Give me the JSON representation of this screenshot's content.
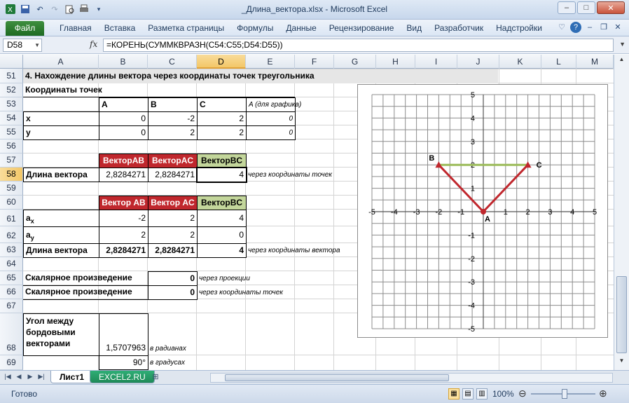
{
  "window": {
    "title": "_Длина_вектора.xlsx - Microsoft Excel",
    "qat_icons": [
      "excel-logo-icon",
      "save-icon",
      "undo-icon",
      "redo-icon",
      "print-preview-icon",
      "quick-print-icon"
    ]
  },
  "ribbon": {
    "file_tab": "Файл",
    "tabs": [
      "Главная",
      "Вставка",
      "Разметка страницы",
      "Формулы",
      "Данные",
      "Рецензирование",
      "Вид",
      "Разработчик",
      "Надстройки"
    ]
  },
  "formula_bar": {
    "name_box": "D58",
    "fx_label": "fx",
    "formula": "=КОРЕНЬ(СУММКВРАЗН(C54:C55;D54:D55))"
  },
  "columns": [
    "A",
    "B",
    "C",
    "D",
    "E",
    "F",
    "G",
    "H",
    "I",
    "J",
    "K",
    "L",
    "M"
  ],
  "rows": [
    "51",
    "52",
    "53",
    "54",
    "55",
    "56",
    "57",
    "58",
    "59",
    "60",
    "61",
    "62",
    "63",
    "64",
    "65",
    "66",
    "67",
    "68",
    "69"
  ],
  "selected": {
    "column": "D",
    "row": "58"
  },
  "cells": {
    "r51": "4. Нахождение длины вектора через координаты точек треугольника",
    "r52": "Координаты точек",
    "r53": {
      "B": "A",
      "C": "B",
      "D": "C",
      "E": "A (для графика)"
    },
    "r54": {
      "A": "x",
      "B": "0",
      "C": "-2",
      "D": "2",
      "E": "0"
    },
    "r55": {
      "A": "y",
      "B": "0",
      "C": "2",
      "D": "2",
      "E": "0"
    },
    "r57": {
      "B": "ВекторAB",
      "C": "ВекторAC",
      "D": "ВекторBC"
    },
    "r58": {
      "A": "Длина вектора",
      "B": "2,8284271",
      "C": "2,8284271",
      "D": "4",
      "E": "через координаты точек"
    },
    "r60": {
      "B": "Вектор AB",
      "C": "Вектор AC",
      "D": "ВекторBC"
    },
    "r61": {
      "A_main": "a",
      "A_sub": "x",
      "B": "-2",
      "C": "2",
      "D": "4"
    },
    "r62": {
      "A_main": "a",
      "A_sub": "y",
      "B": "2",
      "C": "2",
      "D": "0"
    },
    "r63": {
      "A": "Длина вектора",
      "B": "2,8284271",
      "C": "2,8284271",
      "D": "4",
      "E": "через координаты вектора"
    },
    "r65": {
      "A": "Скалярное произведение",
      "D": "0",
      "E": "через проекции"
    },
    "r66": {
      "A": "Скалярное произведение",
      "D": "0",
      "E": "через координаты точек"
    },
    "r68": {
      "A1": "Угол между",
      "A2": "бордовыми",
      "A3": "векторами",
      "B": "1,5707963",
      "C": "в радианах"
    },
    "r69": {
      "B": "90°",
      "C": "в градусах"
    }
  },
  "chart_data": {
    "type": "scatter",
    "xlim": [
      -5,
      5
    ],
    "ylim": [
      -5,
      5
    ],
    "grid": true,
    "x_ticks": [
      "-5",
      "-4",
      "-3",
      "-2",
      "-1",
      "0",
      "1",
      "2",
      "3",
      "4",
      "5"
    ],
    "y_ticks": [
      "5",
      "4",
      "3",
      "2",
      "1",
      "0",
      "-1",
      "-2",
      "-3",
      "-4",
      "-5"
    ],
    "points": [
      {
        "label": "A",
        "x": 0,
        "y": 0
      },
      {
        "label": "B",
        "x": -2,
        "y": 2
      },
      {
        "label": "C",
        "x": 2,
        "y": 2
      }
    ],
    "series": [
      {
        "from": [
          0,
          0
        ],
        "to": [
          -2,
          2
        ],
        "color": "#c0272d"
      },
      {
        "from": [
          0,
          0
        ],
        "to": [
          2,
          2
        ],
        "color": "#c0272d"
      },
      {
        "from": [
          -2,
          2
        ],
        "to": [
          2,
          2
        ],
        "color": "#9bbb59"
      }
    ]
  },
  "sheets": {
    "active": "Лист1",
    "other": "EXCEL2.RU"
  },
  "status": {
    "ready": "Готово",
    "zoom": "100%"
  }
}
